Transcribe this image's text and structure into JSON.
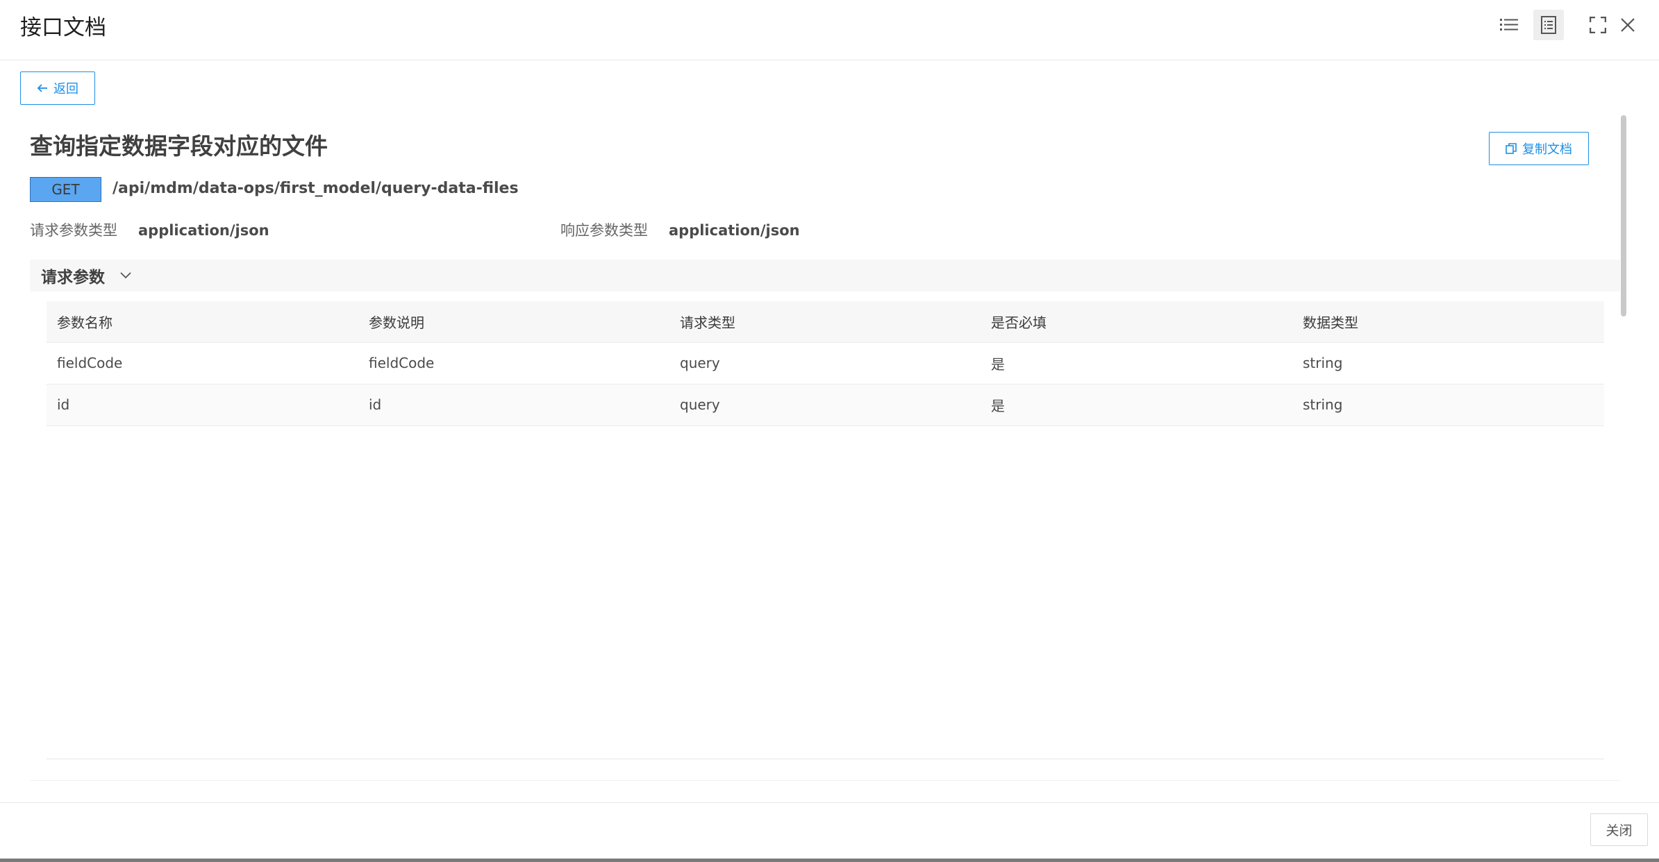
{
  "header": {
    "title": "接口文档",
    "icons": [
      "list-icon",
      "document-icon",
      "fullscreen-icon",
      "close-icon"
    ]
  },
  "back_button": {
    "label": "返回",
    "icon": "arrow-left-icon"
  },
  "doc": {
    "title": "查询指定数据字段对应的文件",
    "copy_label": "复制文档",
    "method": "GET",
    "path": "/api/mdm/data-ops/first_model/query-data-files",
    "request_type_label": "请求参数类型",
    "request_type_value": "application/json",
    "response_type_label": "响应参数类型",
    "response_type_value": "application/json"
  },
  "request_params": {
    "section_title": "请求参数",
    "columns": [
      "参数名称",
      "参数说明",
      "请求类型",
      "是否必填",
      "数据类型"
    ],
    "rows": [
      [
        "fieldCode",
        "fieldCode",
        "query",
        "是",
        "string"
      ],
      [
        "id",
        "id",
        "query",
        "是",
        "string"
      ]
    ]
  },
  "footer": {
    "close_label": "关闭"
  },
  "colors": {
    "accent": "#1b8fe6",
    "method_badge": "#5aa6f0"
  }
}
